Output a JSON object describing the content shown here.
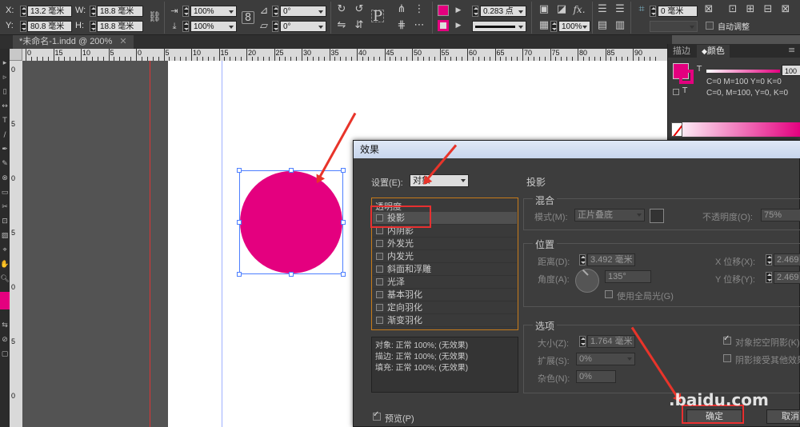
{
  "control_bar": {
    "x_label": "X:",
    "x_value": "13.2 毫米",
    "y_label": "Y:",
    "y_value": "80.8 毫米",
    "w_label": "W:",
    "w_value": "18.8 毫米",
    "h_label": "H:",
    "h_value": "18.8 毫米",
    "scale_x": "100%",
    "scale_y": "100%",
    "rotate": "0°",
    "shear": "0°",
    "stroke_weight": "0.283 点",
    "opacity": "100%",
    "offset_value": "0 毫米",
    "auto_fit_label": "自动调整",
    "fx_label": "fx.",
    "text_frame_label": "P"
  },
  "document_tab": {
    "title": "*未命名-1.indd @ 200%"
  },
  "ruler": {
    "h_numbers": [
      "0",
      "15",
      "10",
      "5",
      "0",
      "5",
      "10",
      "15",
      "20",
      "25",
      "30",
      "35",
      "40",
      "45",
      "50",
      "55",
      "60",
      "65",
      "70",
      "75",
      "80",
      "85",
      "90"
    ],
    "v_numbers": [
      "0",
      "5",
      "0",
      "5",
      "0",
      "5",
      "0"
    ]
  },
  "colors": {
    "fill": "#e4007f",
    "selection": "#4d7fff",
    "highlight": "#e83030"
  },
  "color_panel": {
    "tabs": [
      "描边",
      "颜色"
    ],
    "active_tab": "颜色",
    "tint_value": "100",
    "fill_readout": "C=0 M=100 Y=0 K=0",
    "stroke_readout": "C=0, M=100, Y=0, K=0",
    "t_label": "T"
  },
  "dialog": {
    "title": "效果",
    "settings_label": "设置(E):",
    "settings_value": "对象",
    "section_title": "投影",
    "transparency_heading": "透明度",
    "effects": [
      "投影",
      "内阴影",
      "外发光",
      "内发光",
      "斜面和浮雕",
      "光泽",
      "基本羽化",
      "定向羽化",
      "渐变羽化"
    ],
    "summary": [
      "对象: 正常 100%; (无效果)",
      "描边: 正常 100%; (无效果)",
      "填充: 正常 100%; (无效果)"
    ],
    "blend": {
      "group": "混合",
      "mode_label": "模式(M):",
      "mode_value": "正片叠底",
      "opacity_label": "不透明度(O):",
      "opacity_value": "75%"
    },
    "position": {
      "group": "位置",
      "distance_label": "距离(D):",
      "distance_value": "3.492 毫米",
      "angle_label": "角度(A):",
      "angle_value": "135°",
      "global_light_label": "使用全局光(G)",
      "x_offset_label": "X 位移(X):",
      "x_offset_value": "2.469 毫",
      "y_offset_label": "Y 位移(Y):",
      "y_offset_value": "2.469 毫"
    },
    "options": {
      "group": "选项",
      "size_label": "大小(Z):",
      "size_value": "1.764 毫米",
      "spread_label": "扩展(S):",
      "spread_value": "0%",
      "noise_label": "杂色(N):",
      "noise_value": "0%",
      "knockout_label": "对象挖空阴影(K)",
      "honor_label": "阴影接受其他效果"
    },
    "preview_label": "预览(P)",
    "ok_label": "确定",
    "cancel_label": "取消"
  },
  "watermark": ".baidu.com"
}
